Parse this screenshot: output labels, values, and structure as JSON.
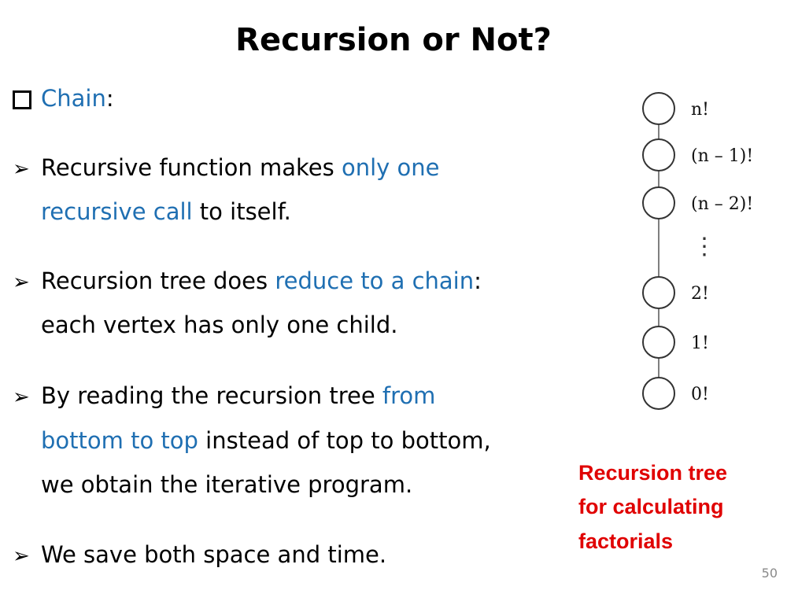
{
  "slide": {
    "title": "Recursion or Not?",
    "page_number": "50"
  },
  "heading": {
    "keyword": "Chain",
    "colon": ":"
  },
  "bullets": [
    {
      "pre": "Recursive function makes ",
      "hl": "only one",
      "hl2": "recursive call",
      "post": " to itself."
    },
    {
      "pre": "Recursion tree does ",
      "hl": "reduce to a chain",
      "post": ":",
      "line2": "each vertex has only one child."
    },
    {
      "pre": "By reading the recursion tree ",
      "hl": "from",
      "hl2": "bottom to top",
      "post": " instead of top to bottom,",
      "line3": "we obtain the iterative program."
    },
    {
      "text": "We save both space and time."
    }
  ],
  "figure": {
    "node_labels": [
      "n!",
      "(n – 1)!",
      "(n – 2)!",
      "2!",
      "1!",
      "0!"
    ],
    "ellipsis": "⋮",
    "caption_lines": [
      "Recursion tree",
      "for calculating",
      "factorials"
    ]
  },
  "colors": {
    "highlight": "#1f6fb2",
    "caption": "#e00000"
  }
}
